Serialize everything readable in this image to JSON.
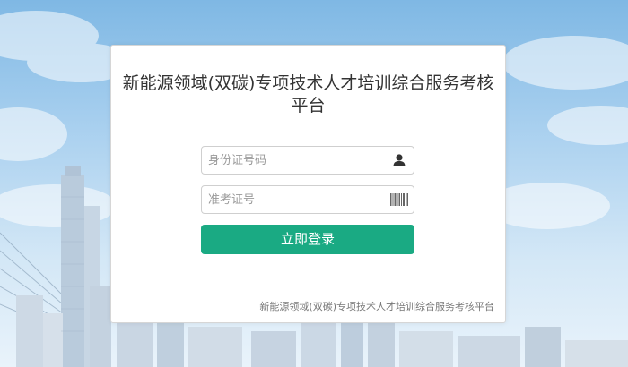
{
  "platform_title": "新能源领域(双碳)专项技术人才培训综合服务考核平台",
  "login": {
    "id_placeholder": "身份证号码",
    "id_value": "",
    "exam_placeholder": "准考证号",
    "exam_value": "",
    "submit_label": "立即登录"
  },
  "footer_text": "新能源领域(双碳)专项技术人才培训综合服务考核平台",
  "colors": {
    "accent": "#1aaa83",
    "sky_top": "#7fb8e4",
    "sky_bottom": "#e9f3fb"
  },
  "icons": {
    "id_icon": "user-icon",
    "exam_icon": "barcode-icon"
  }
}
